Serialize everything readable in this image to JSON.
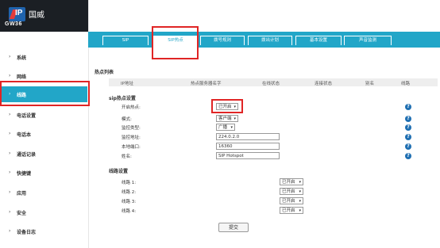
{
  "brand": {
    "name": "国威",
    "model": "GW36"
  },
  "sidebar": {
    "items": [
      {
        "label": "系统"
      },
      {
        "label": "网络"
      },
      {
        "label": "线路"
      },
      {
        "label": "电话设置"
      },
      {
        "label": "电话本"
      },
      {
        "label": "通话记录"
      },
      {
        "label": "快捷键"
      },
      {
        "label": "应用"
      },
      {
        "label": "安全"
      },
      {
        "label": "设备日志"
      }
    ],
    "arrow": "›"
  },
  "tabs": [
    {
      "label": "SIP"
    },
    {
      "label": "SIP热点"
    },
    {
      "label": "拨号规则"
    },
    {
      "label": "拨出计划"
    },
    {
      "label": "基本设置"
    },
    {
      "label": "声音监测"
    }
  ],
  "hotspot_list": {
    "title": "热点列表",
    "columns": [
      "IP地址",
      "热点服务器名字",
      "在线状态",
      "连接状态",
      "别名",
      "线路"
    ]
  },
  "sip_hotspot_settings": {
    "title": "sip热点设置",
    "fields": {
      "enable": {
        "label": "开启热点:",
        "value": "已开启"
      },
      "mode": {
        "label": "模式:",
        "value": "客户端"
      },
      "monitor_type": {
        "label": "监控类型:",
        "value": "广播"
      },
      "monitor_address": {
        "label": "监控地址:",
        "value": "224.0.2.0"
      },
      "local_port": {
        "label": "本地端口:",
        "value": "16360"
      },
      "name": {
        "label": "姓名:",
        "value": "SIP Hotspot"
      }
    },
    "help_glyph": "?"
  },
  "line_settings": {
    "title": "线路设置",
    "lines": [
      {
        "label": "线路 1:",
        "value": "已开启"
      },
      {
        "label": "线路 2:",
        "value": "已开启"
      },
      {
        "label": "线路 3:",
        "value": "已开启"
      },
      {
        "label": "线路 4:",
        "value": "已开启"
      }
    ]
  },
  "submit_label": "提交",
  "caret": "▾"
}
